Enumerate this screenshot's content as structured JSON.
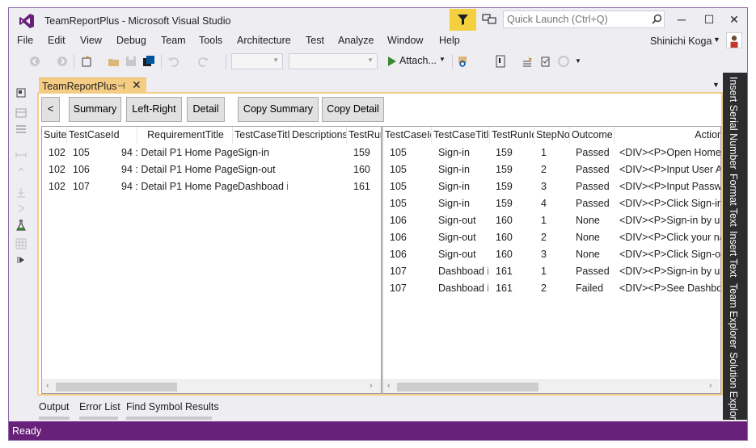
{
  "window": {
    "title": "TeamReportPlus - Microsoft Visual Studio",
    "quick_launch_placeholder": "Quick Launch (Ctrl+Q)",
    "minimize": "─",
    "maximize": "☐",
    "close": "✕"
  },
  "menu": {
    "items": [
      "File",
      "Edit",
      "View",
      "Debug",
      "Team",
      "Tools",
      "Architecture",
      "Test",
      "Analyze",
      "Window",
      "Help"
    ],
    "user_name": "Shinichi Koga",
    "user_caret": "▼"
  },
  "toolbar": {
    "attach_label": "Attach...",
    "attach_caret": "▼"
  },
  "document": {
    "tab_label": "TeamReportPlus",
    "pin": "⊣",
    "close": "✕",
    "tabs_dropdown": "▼"
  },
  "buttons": {
    "back": "<",
    "summary": "Summary",
    "left_right": "Left-Right",
    "detail": "Detail",
    "copy_summary": "Copy Summary",
    "copy_detail": "Copy Detail"
  },
  "left_grid": {
    "columns": [
      "Suite",
      "TestCaseId",
      "RequirementTitle",
      "TestCaseTitle",
      "Descriptions",
      "TestRunId"
    ],
    "rows": [
      [
        "102",
        "105",
        "94 : Detail P1 Home Page",
        "Sign-in",
        "",
        "159"
      ],
      [
        "102",
        "106",
        "94 : Detail P1 Home Page",
        "Sign-out",
        "",
        "160"
      ],
      [
        "102",
        "107",
        "94 : Detail P1 Home Page",
        "Dashboad in",
        "",
        "161"
      ]
    ],
    "scroll_left": "‹",
    "scroll_right": "›"
  },
  "right_grid": {
    "columns": [
      "TestCaseId",
      "TestCaseTitle",
      "TestRunId",
      "StepNo",
      "Outcome",
      "Action"
    ],
    "rows": [
      [
        "105",
        "Sign-in",
        "159",
        "1",
        "Passed",
        "<DIV><P>Open Home"
      ],
      [
        "105",
        "Sign-in",
        "159",
        "2",
        "Passed",
        "<DIV><P>Input User Account"
      ],
      [
        "105",
        "Sign-in",
        "159",
        "3",
        "Passed",
        "<DIV><P>Input Password"
      ],
      [
        "105",
        "Sign-in",
        "159",
        "4",
        "Passed",
        "<DIV><P>Click Sign-in"
      ],
      [
        "106",
        "Sign-out",
        "160",
        "1",
        "None",
        "<DIV><P>Sign-in by user"
      ],
      [
        "106",
        "Sign-out",
        "160",
        "2",
        "None",
        "<DIV><P>Click your name"
      ],
      [
        "106",
        "Sign-out",
        "160",
        "3",
        "None",
        "<DIV><P>Click Sign-out"
      ],
      [
        "107",
        "Dashboad in",
        "161",
        "1",
        "Passed",
        "<DIV><P>Sign-in by user"
      ],
      [
        "107",
        "Dashboad in",
        "161",
        "2",
        "Failed",
        "<DIV><P>See Dashboard"
      ]
    ],
    "scroll_left": "‹",
    "scroll_right": "›"
  },
  "side_tabs": [
    "Insert Serial Number",
    "Format Text",
    "Insert Text",
    "Team Explorer",
    "Solution Explorer"
  ],
  "bottom_tabs": [
    "Output",
    "Error List",
    "Find Symbol Results"
  ],
  "status": {
    "text": "Ready"
  },
  "colors": {
    "accent_purple": "#68217a",
    "doc_tab": "#f5cc84",
    "filter_yellow": "#f4d03f",
    "chrome": "#eeeef2"
  }
}
